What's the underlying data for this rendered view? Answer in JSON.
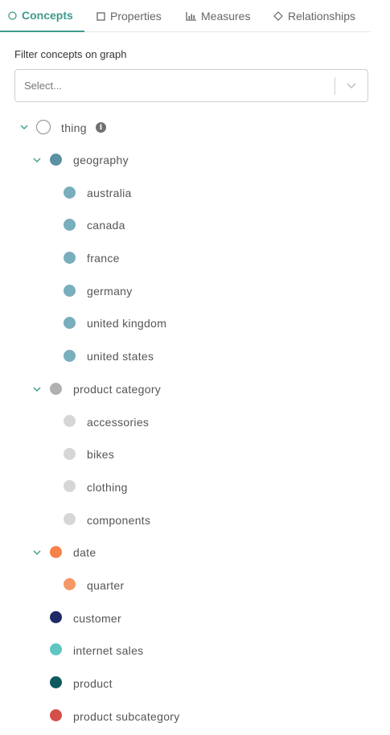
{
  "tabs": [
    {
      "label": "Concepts",
      "icon": "circle-icon",
      "active": true
    },
    {
      "label": "Properties",
      "icon": "square-icon",
      "active": false
    },
    {
      "label": "Measures",
      "icon": "bar-chart-icon",
      "active": false
    },
    {
      "label": "Relationships",
      "icon": "diamond-icon",
      "active": false
    }
  ],
  "filter": {
    "label": "Filter concepts on graph",
    "placeholder": "Select..."
  },
  "colors": {
    "accent": "#3f9a8c",
    "geography": "#5b91a1",
    "geography_child": "#79aebd",
    "product_category": "#b0b0b0",
    "product_category_child": "#d6d6d6",
    "date": "#f4834b",
    "date_child": "#f59865",
    "customer": "#1f2a66",
    "internet_sales": "#5fc6c2",
    "product": "#0f5a5e",
    "product_subcategory": "#d34f48"
  },
  "tree": {
    "root": {
      "label": "thing",
      "info_icon": "info-icon"
    },
    "geography": {
      "label": "geography",
      "children": [
        "australia",
        "canada",
        "france",
        "germany",
        "united kingdom",
        "united states"
      ]
    },
    "product_category": {
      "label": "product category",
      "children": [
        "accessories",
        "bikes",
        "clothing",
        "components"
      ]
    },
    "date": {
      "label": "date",
      "children": [
        "quarter"
      ]
    },
    "leaves": [
      "customer",
      "internet sales",
      "product",
      "product subcategory"
    ]
  }
}
